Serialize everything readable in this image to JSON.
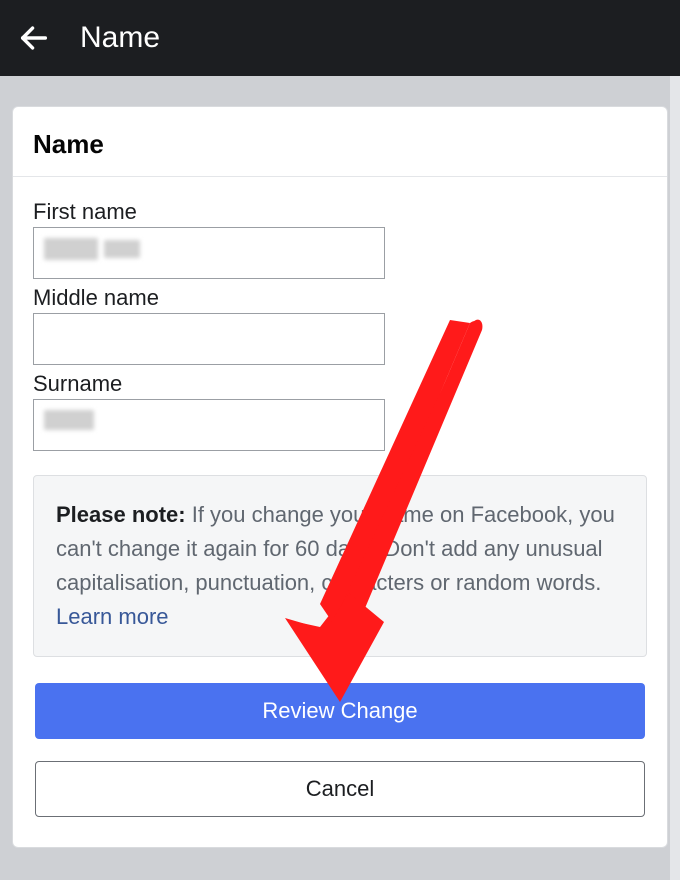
{
  "header": {
    "title": "Name"
  },
  "card": {
    "title": "Name",
    "fields": {
      "first_label": "First name",
      "first_value": "",
      "middle_label": "Middle name",
      "middle_value": "",
      "surname_label": "Surname",
      "surname_value": ""
    },
    "note": {
      "prefix": "Please note:",
      "text": " If you change your name on Facebook, you can't change it again for 60 days. Don't add any unusual capitalisation, punctuation, characters or random words. ",
      "link": "Learn more"
    },
    "buttons": {
      "review": "Review Change",
      "cancel": "Cancel"
    }
  },
  "colors": {
    "primary": "#4a72f0",
    "arrow": "#ff1a1a"
  }
}
